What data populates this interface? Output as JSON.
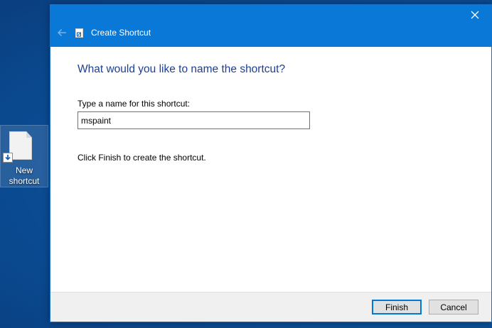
{
  "desktop": {
    "shortcut_icon": {
      "icon": "shortcut-file-icon",
      "label_line1": "New",
      "label_line2": "shortcut"
    }
  },
  "dialog": {
    "title": "Create Shortcut",
    "heading": "What would you like to name the shortcut?",
    "field_label": "Type a name for this shortcut:",
    "name_value": "mspaint",
    "info_text": "Click Finish to create the shortcut.",
    "buttons": {
      "finish_label": "Finish",
      "cancel_label": "Cancel"
    }
  },
  "colors": {
    "titlebar": "#0a78d7",
    "heading": "#1c3f94",
    "desktop": "#0b4f98"
  }
}
